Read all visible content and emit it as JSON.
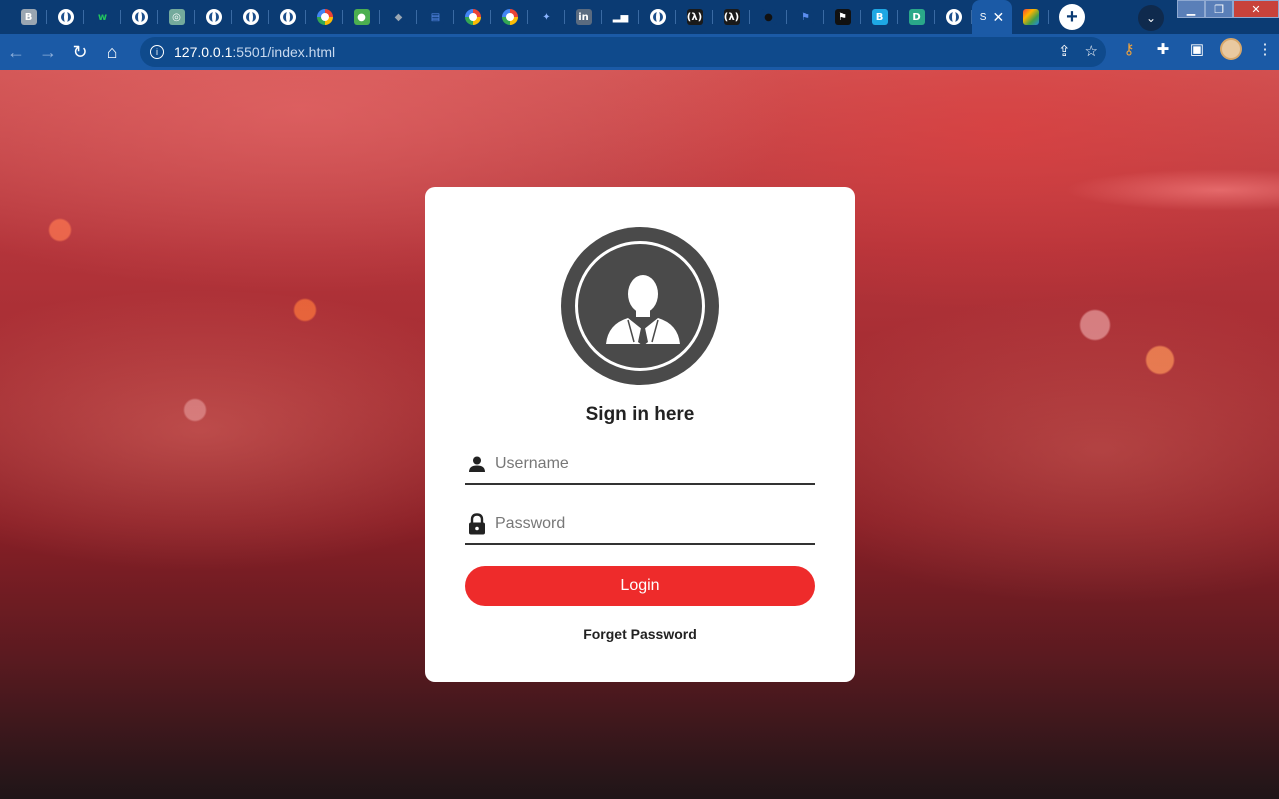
{
  "browser": {
    "tabs": [
      {
        "icon": "b-icon",
        "text": "B",
        "color": "#9aa6b2"
      },
      {
        "icon": "globe-icon"
      },
      {
        "icon": "w-icon",
        "text": "w",
        "color": "#0b3b73",
        "fg": "#22c55e"
      },
      {
        "icon": "globe-icon"
      },
      {
        "icon": "openai-icon",
        "text": "◎",
        "color": "#74aa9c"
      },
      {
        "icon": "globe-icon"
      },
      {
        "icon": "globe-icon"
      },
      {
        "icon": "globe-icon"
      },
      {
        "icon": "google-icon"
      },
      {
        "icon": "leaf-icon",
        "text": "●",
        "color": "#4caf50"
      },
      {
        "icon": "layers-icon",
        "text": "◆",
        "color": "#0b3b73",
        "fg": "#9aa6b2"
      },
      {
        "icon": "form-icon",
        "text": "▤",
        "color": "#0b3b73",
        "fg": "#5b8def"
      },
      {
        "icon": "google-icon"
      },
      {
        "icon": "google-icon"
      },
      {
        "icon": "sparkle-icon",
        "text": "✦",
        "color": "#0b3b73",
        "fg": "#8ab4ff"
      },
      {
        "icon": "linkedin-icon",
        "text": "in",
        "color": "#5a6b80"
      },
      {
        "icon": "bars-icon",
        "text": "▂▅",
        "color": "#0b3b73",
        "fg": "#ffffff"
      },
      {
        "icon": "globe-icon"
      },
      {
        "icon": "lambda-icon",
        "text": "(λ)",
        "color": "#1a1a1a"
      },
      {
        "icon": "lambda-icon",
        "text": "(λ)",
        "color": "#1a1a1a"
      },
      {
        "icon": "github-icon",
        "text": "●",
        "color": "#0b3b73",
        "fg": "#111"
      },
      {
        "icon": "flag-icon",
        "text": "⚑",
        "color": "#0b3b73",
        "fg": "#5b8def"
      },
      {
        "icon": "flag-icon",
        "text": "⚑",
        "color": "#111"
      },
      {
        "icon": "b-icon",
        "text": "B",
        "color": "#1ea7e4"
      },
      {
        "icon": "d-icon",
        "text": "D",
        "color": "#2aa889"
      },
      {
        "icon": "globe-icon"
      }
    ],
    "active_tab_label": "S",
    "close_glyph": "✕",
    "newtab_glyph": "+",
    "url_host": "127.0.0.1",
    "url_rest": ":5501/index.html"
  },
  "login": {
    "title": "Sign in here",
    "username_placeholder": "Username",
    "password_placeholder": "Password",
    "login_label": "Login",
    "forget_label": "Forget Password"
  },
  "colors": {
    "accent": "#ee2b2b",
    "avatar_bg": "#4a4a4a"
  }
}
